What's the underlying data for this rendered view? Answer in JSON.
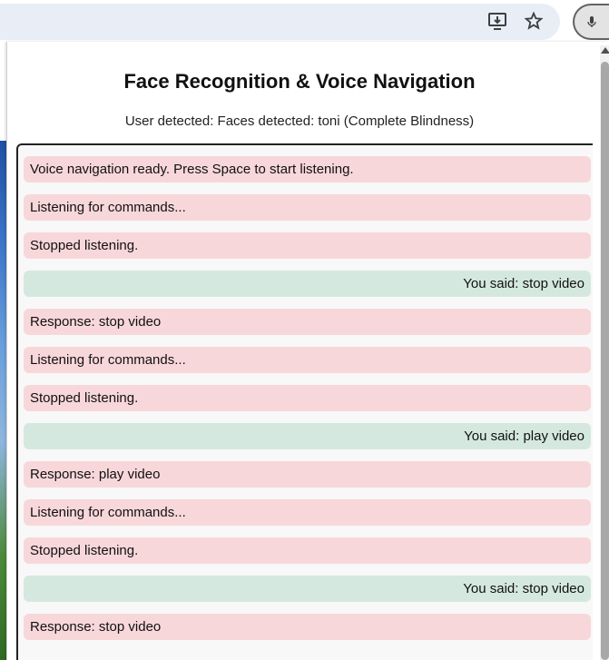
{
  "browser": {
    "install_icon": "install-app-icon",
    "star_icon": "bookmark-star-icon",
    "extension_icon": "microphone-icon"
  },
  "popup": {
    "title": "Face Recognition & Voice Navigation",
    "status": "User detected: Faces detected: toni (Complete Blindness)"
  },
  "log": {
    "messages": [
      {
        "role": "system",
        "text": "Voice navigation ready. Press Space to start listening."
      },
      {
        "role": "system",
        "text": "Listening for commands..."
      },
      {
        "role": "system",
        "text": "Stopped listening."
      },
      {
        "role": "user",
        "text": "You said: stop video"
      },
      {
        "role": "system",
        "text": "Response: stop video"
      },
      {
        "role": "system",
        "text": "Listening for commands..."
      },
      {
        "role": "system",
        "text": "Stopped listening."
      },
      {
        "role": "user",
        "text": "You said: play video"
      },
      {
        "role": "system",
        "text": "Response: play video"
      },
      {
        "role": "system",
        "text": "Listening for commands..."
      },
      {
        "role": "system",
        "text": "Stopped listening."
      },
      {
        "role": "user",
        "text": "You said: stop video"
      },
      {
        "role": "system",
        "text": "Response: stop video"
      }
    ]
  },
  "colors": {
    "system_bg": "#f8d7da",
    "user_bg": "#d4e8df"
  }
}
